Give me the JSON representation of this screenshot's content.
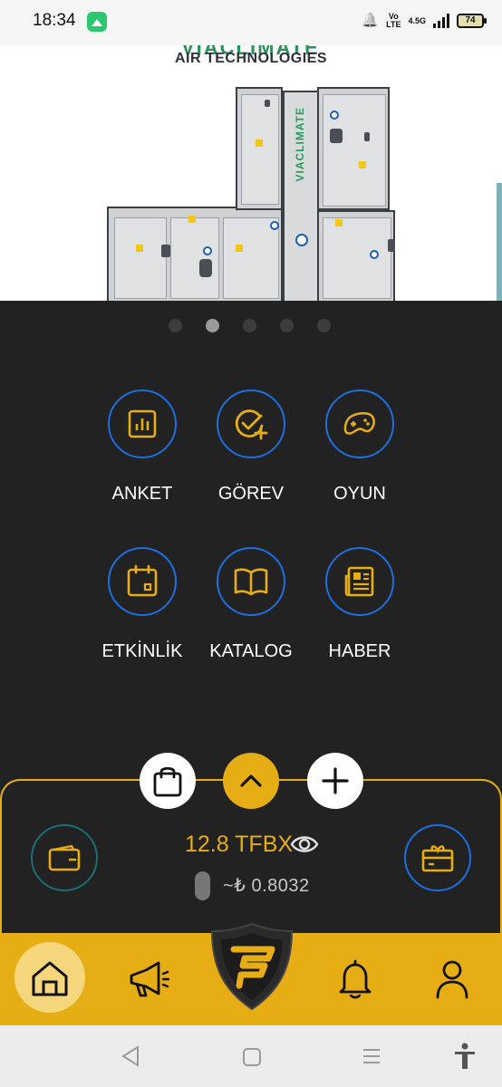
{
  "status_bar": {
    "time": "18:34",
    "volte": "Vo\nLTE",
    "network": "4.5G",
    "battery": "74"
  },
  "banner": {
    "brand_top": "VIACLIMATE",
    "brand": "AIR TECHNOLOGIES",
    "unit_label": "VIACLIMATE",
    "carousel_count": 5,
    "carousel_active": 2
  },
  "menu": {
    "items": [
      {
        "label": "ANKET",
        "icon": "chart-icon"
      },
      {
        "label": "GÖREV",
        "icon": "task-add-icon"
      },
      {
        "label": "OYUN",
        "icon": "gamepad-icon"
      },
      {
        "label": "ETKİNLİK",
        "icon": "calendar-icon"
      },
      {
        "label": "KATALOG",
        "icon": "book-icon"
      },
      {
        "label": "HABER",
        "icon": "newspaper-icon"
      }
    ]
  },
  "wallet": {
    "balance": "12.8 TFBX",
    "tl_value": "~₺ 0.8032"
  },
  "colors": {
    "accent": "#e6ad14",
    "icon_border": "#1d6fe0",
    "background": "#222222"
  }
}
